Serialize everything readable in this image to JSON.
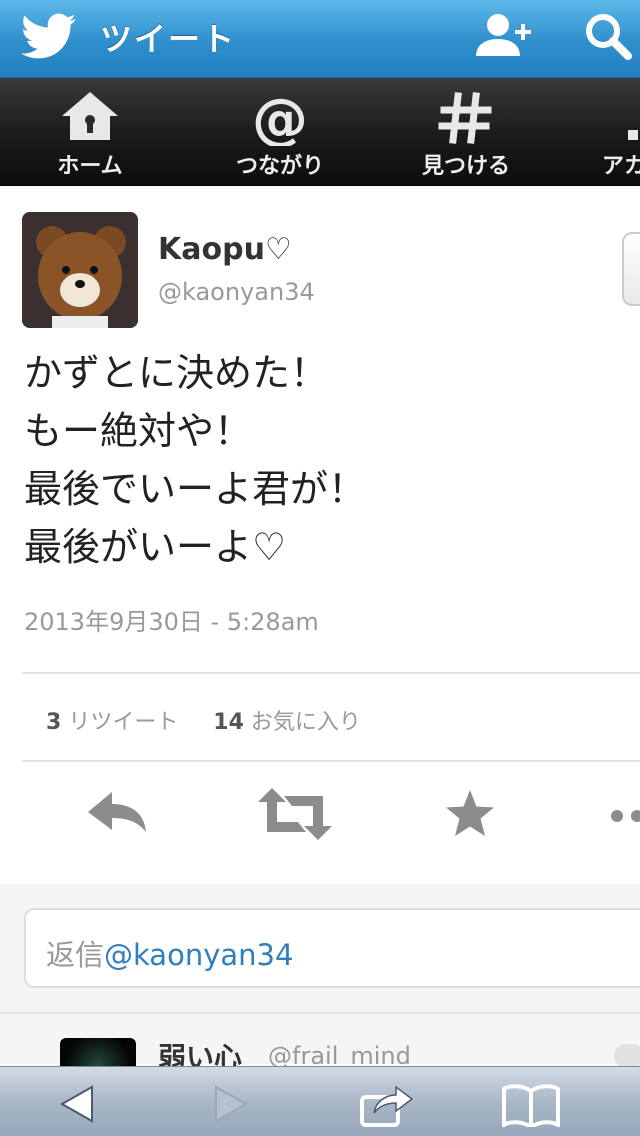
{
  "header": {
    "title": "ツイート",
    "icons": {
      "logo": "twitter-bird-icon",
      "add_user": "add-user-icon",
      "search": "search-icon"
    }
  },
  "nav": {
    "items": [
      {
        "label": "ホーム",
        "icon": "home-icon"
      },
      {
        "label": "つながり",
        "icon": "at-sign-icon"
      },
      {
        "label": "見つける",
        "icon": "hashtag-icon"
      },
      {
        "label": "アカ",
        "icon": "account-icon"
      }
    ]
  },
  "tweet": {
    "user_name": "Kaopu♡",
    "user_handle": "@kaonyan34",
    "text": "かずとに決めた！\nもー絶対や！\n最後でいーよ君が！\n最後がいーよ♡",
    "timestamp": "2013年9月30日 - 5:28am",
    "retweet_count": "3",
    "retweet_label": "リツイート",
    "favorite_count": "14",
    "favorite_label": "お気に入り"
  },
  "actions": {
    "reply": "reply-icon",
    "retweet": "retweet-icon",
    "favorite": "star-icon",
    "more": "more-icon"
  },
  "reply_box": {
    "prefix": "返信",
    "handle": "@kaonyan34"
  },
  "next_tweet": {
    "user_name": "弱い心",
    "user_handle": "@frail_mind"
  },
  "browser_toolbar": {
    "back": "back-arrow-icon",
    "forward": "forward-arrow-icon",
    "share": "share-icon",
    "bookmarks": "bookmarks-icon"
  },
  "colors": {
    "header_blue": "#2f8fcd",
    "link_blue": "#2f7fbf",
    "nav_dark": "#1c1c1c"
  }
}
